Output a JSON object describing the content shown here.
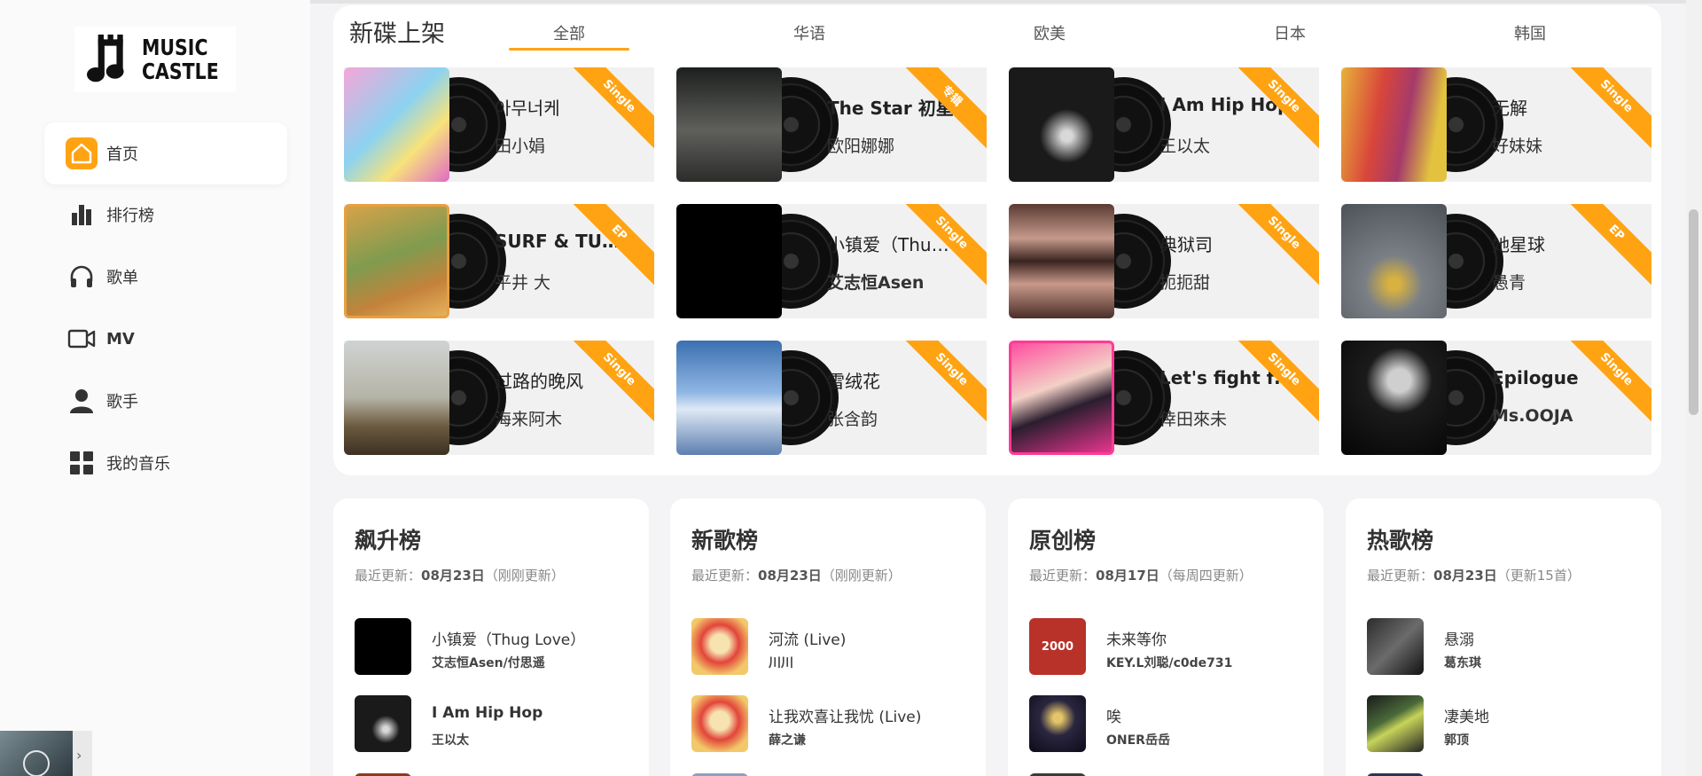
{
  "sidebar": {
    "logo_text": "MUSIC CASTLE",
    "items": [
      {
        "label": "首页",
        "icon": "home-icon",
        "active": true
      },
      {
        "label": "排行榜",
        "icon": "bar-chart-icon"
      },
      {
        "label": "歌单",
        "icon": "headphones-icon"
      },
      {
        "label": "MV",
        "icon": "video-icon"
      },
      {
        "label": "歌手",
        "icon": "user-icon"
      },
      {
        "label": "我的音乐",
        "icon": "grid-icon"
      }
    ]
  },
  "albums": {
    "title": "新碟上架",
    "tabs": [
      "全部",
      "华语",
      "欧美",
      "日本",
      "韩国"
    ],
    "active_tab": "全部",
    "items": [
      {
        "title": "아무너케",
        "artist": "田小娟",
        "badge": "Single"
      },
      {
        "title": "The Star 初星",
        "artist": "欧阳娜娜",
        "badge": "专辑"
      },
      {
        "title": "I Am Hip Hop",
        "artist": "王以太",
        "badge": "Single"
      },
      {
        "title": "无解",
        "artist": "好妹妹",
        "badge": "Single"
      },
      {
        "title": "SURF & TURF (D...",
        "artist": "平井 大",
        "badge": "EP"
      },
      {
        "title": "小镇爱（Thug L...",
        "artist": "艾志恒Asen",
        "badge": "Single"
      },
      {
        "title": "典狱司",
        "artist": "扼扼甜",
        "badge": "Single"
      },
      {
        "title": "她星球",
        "artist": "愚青",
        "badge": "EP"
      },
      {
        "title": "过路的晚风",
        "artist": "海来阿木",
        "badge": "Single"
      },
      {
        "title": "雪绒花",
        "artist": "张含韵",
        "badge": "Single"
      },
      {
        "title": "Let's fight for lo...",
        "artist": "倖田來未",
        "badge": "Single"
      },
      {
        "title": "Epilogue",
        "artist": "Ms.OOJA",
        "badge": "Single"
      }
    ]
  },
  "charts": [
    {
      "title": "飙升榜",
      "update_prefix": "最近更新：",
      "date": "08月23日",
      "note": "（刚刚更新）",
      "tracks": [
        {
          "title": "小镇爱（Thug Love）",
          "artist": "艾志恒Asen/付思遥"
        },
        {
          "title": "I Am Hip Hop",
          "artist": "王以太"
        }
      ]
    },
    {
      "title": "新歌榜",
      "update_prefix": "最近更新：",
      "date": "08月23日",
      "note": "（刚刚更新）",
      "tracks": [
        {
          "title": "河流 (Live)",
          "artist": "川川"
        },
        {
          "title": "让我欢喜让我忧 (Live)",
          "artist": "薛之谦"
        }
      ]
    },
    {
      "title": "原创榜",
      "update_prefix": "最近更新：",
      "date": "08月17日",
      "note": "（每周四更新）",
      "tracks": [
        {
          "title": "未来等你",
          "artist": "KEY.L刘聪/c0de731",
          "cover_text": "2000"
        },
        {
          "title": "唉",
          "artist": "ONER岳岳"
        }
      ]
    },
    {
      "title": "热歌榜",
      "update_prefix": "最近更新：",
      "date": "08月23日",
      "note": "（更新15首）",
      "tracks": [
        {
          "title": "悬溺",
          "artist": "葛东琪"
        },
        {
          "title": "凄美地",
          "artist": "郭顶"
        }
      ]
    }
  ],
  "colors": {
    "accent": "#ffa313",
    "card_bg": "#f1f1f1",
    "page_bg": "#f4f4f6"
  }
}
